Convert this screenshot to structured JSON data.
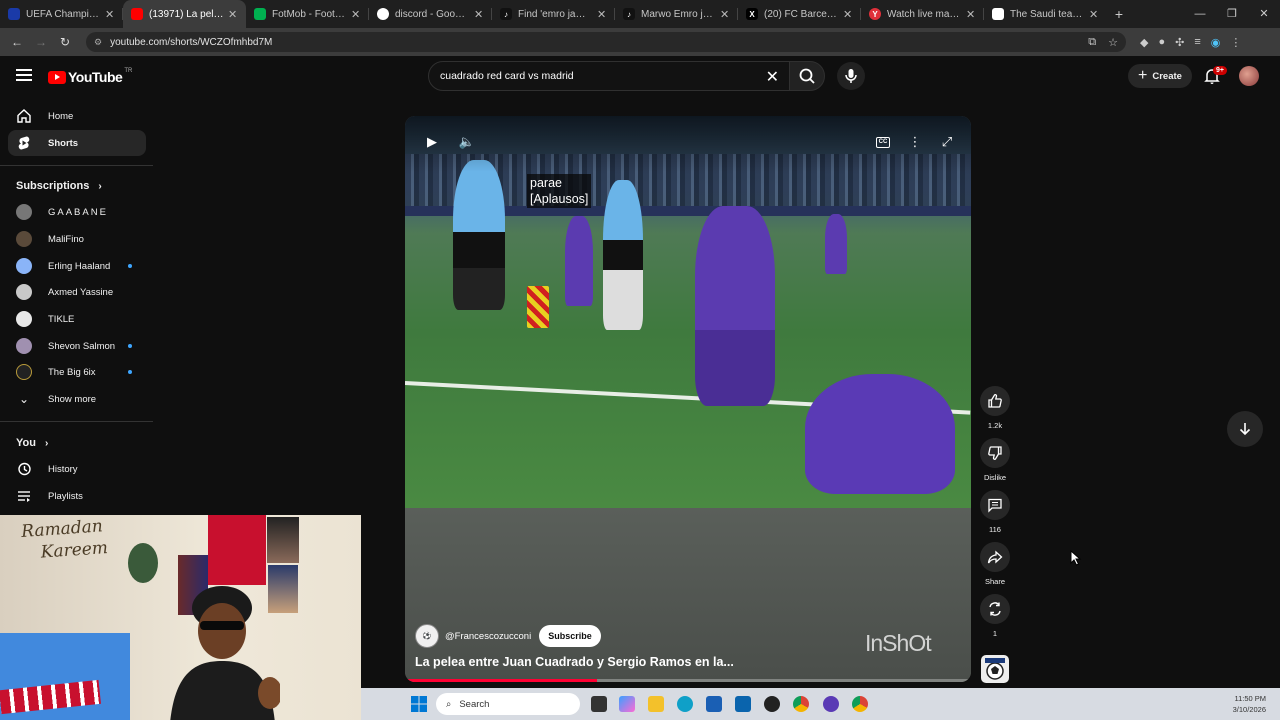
{
  "browser": {
    "tabs": [
      {
        "label": "UEFA Champions Lea",
        "favicon_color": "#1a3aa8"
      },
      {
        "label": "(13971) La pelea e",
        "favicon_color": "#ff0000",
        "active": true
      },
      {
        "label": "FotMob - Football Li",
        "favicon_color": "#00b050"
      },
      {
        "label": "discord - Google Sea",
        "favicon_color": "#ffffff"
      },
      {
        "label": "Find 'emro jamac' on",
        "favicon_color": "#111111"
      },
      {
        "label": "Marwo Emro jama14",
        "favicon_color": "#111111"
      },
      {
        "label": "(20) FC Barcelona (@",
        "favicon_color": "#000000"
      },
      {
        "label": "Watch live matches -",
        "favicon_color": "#e0303a"
      },
      {
        "label": "The Saudi team is int",
        "favicon_color": "#ffffff"
      }
    ],
    "new_tab_label": "+",
    "window_controls": {
      "minimize": "—",
      "maximize": "❐",
      "close": "✕"
    },
    "url": "youtube.com/shorts/WCZOfmhbd7M"
  },
  "masthead": {
    "logo_text": "YouTube",
    "region_code": "TR",
    "search_value": "cuadrado red card vs madrid",
    "clear_icon": "✕",
    "create_label": "Create",
    "notifications_badge": "9+"
  },
  "sidebar": {
    "home_label": "Home",
    "shorts_label": "Shorts",
    "subscriptions_label": "Subscriptions",
    "subscriptions": [
      {
        "name": "GAABANE",
        "color": "#777777",
        "new": false
      },
      {
        "name": "MaliFino",
        "color": "#5a4a3a",
        "new": false
      },
      {
        "name": "Erling Haaland",
        "color": "#8ab4f8",
        "new": true
      },
      {
        "name": "Axmed Yassine",
        "color": "#c9c9c9",
        "new": false
      },
      {
        "name": "TIKLE",
        "color": "#e8e8e8",
        "new": false
      },
      {
        "name": "Shevon Salmon",
        "color": "#a090b0",
        "new": true
      },
      {
        "name": "The Big 6ix",
        "color": "#222222",
        "new": true
      }
    ],
    "show_more_label": "Show more",
    "you_label": "You",
    "history_label": "History",
    "playlists_label": "Playlists"
  },
  "player": {
    "caption_lines": [
      "parae",
      "[Aplausos]"
    ],
    "cc_label": "CC",
    "channel": "@Francescozucconi",
    "subscribe_label": "Subscribe",
    "title": "La pelea entre Juan Cuadrado y Sergio Ramos en la...",
    "watermark": "InShOt",
    "progress_fraction": 0.34
  },
  "actions": {
    "likes": "1.2k",
    "dislike_label": "Dislike",
    "comments": "116",
    "share_label": "Share",
    "remix_count": "1"
  },
  "webcam": {
    "wall_text_line1": "Ramadan",
    "wall_text_line2": "Kareem"
  },
  "taskbar": {
    "search_label": "Search",
    "time": "11:50 PM",
    "date": "3/10/2026"
  },
  "colors": {
    "youtube_red": "#ff0000",
    "subscription_dot": "#3ea6ff",
    "progress": "#ff0033"
  }
}
